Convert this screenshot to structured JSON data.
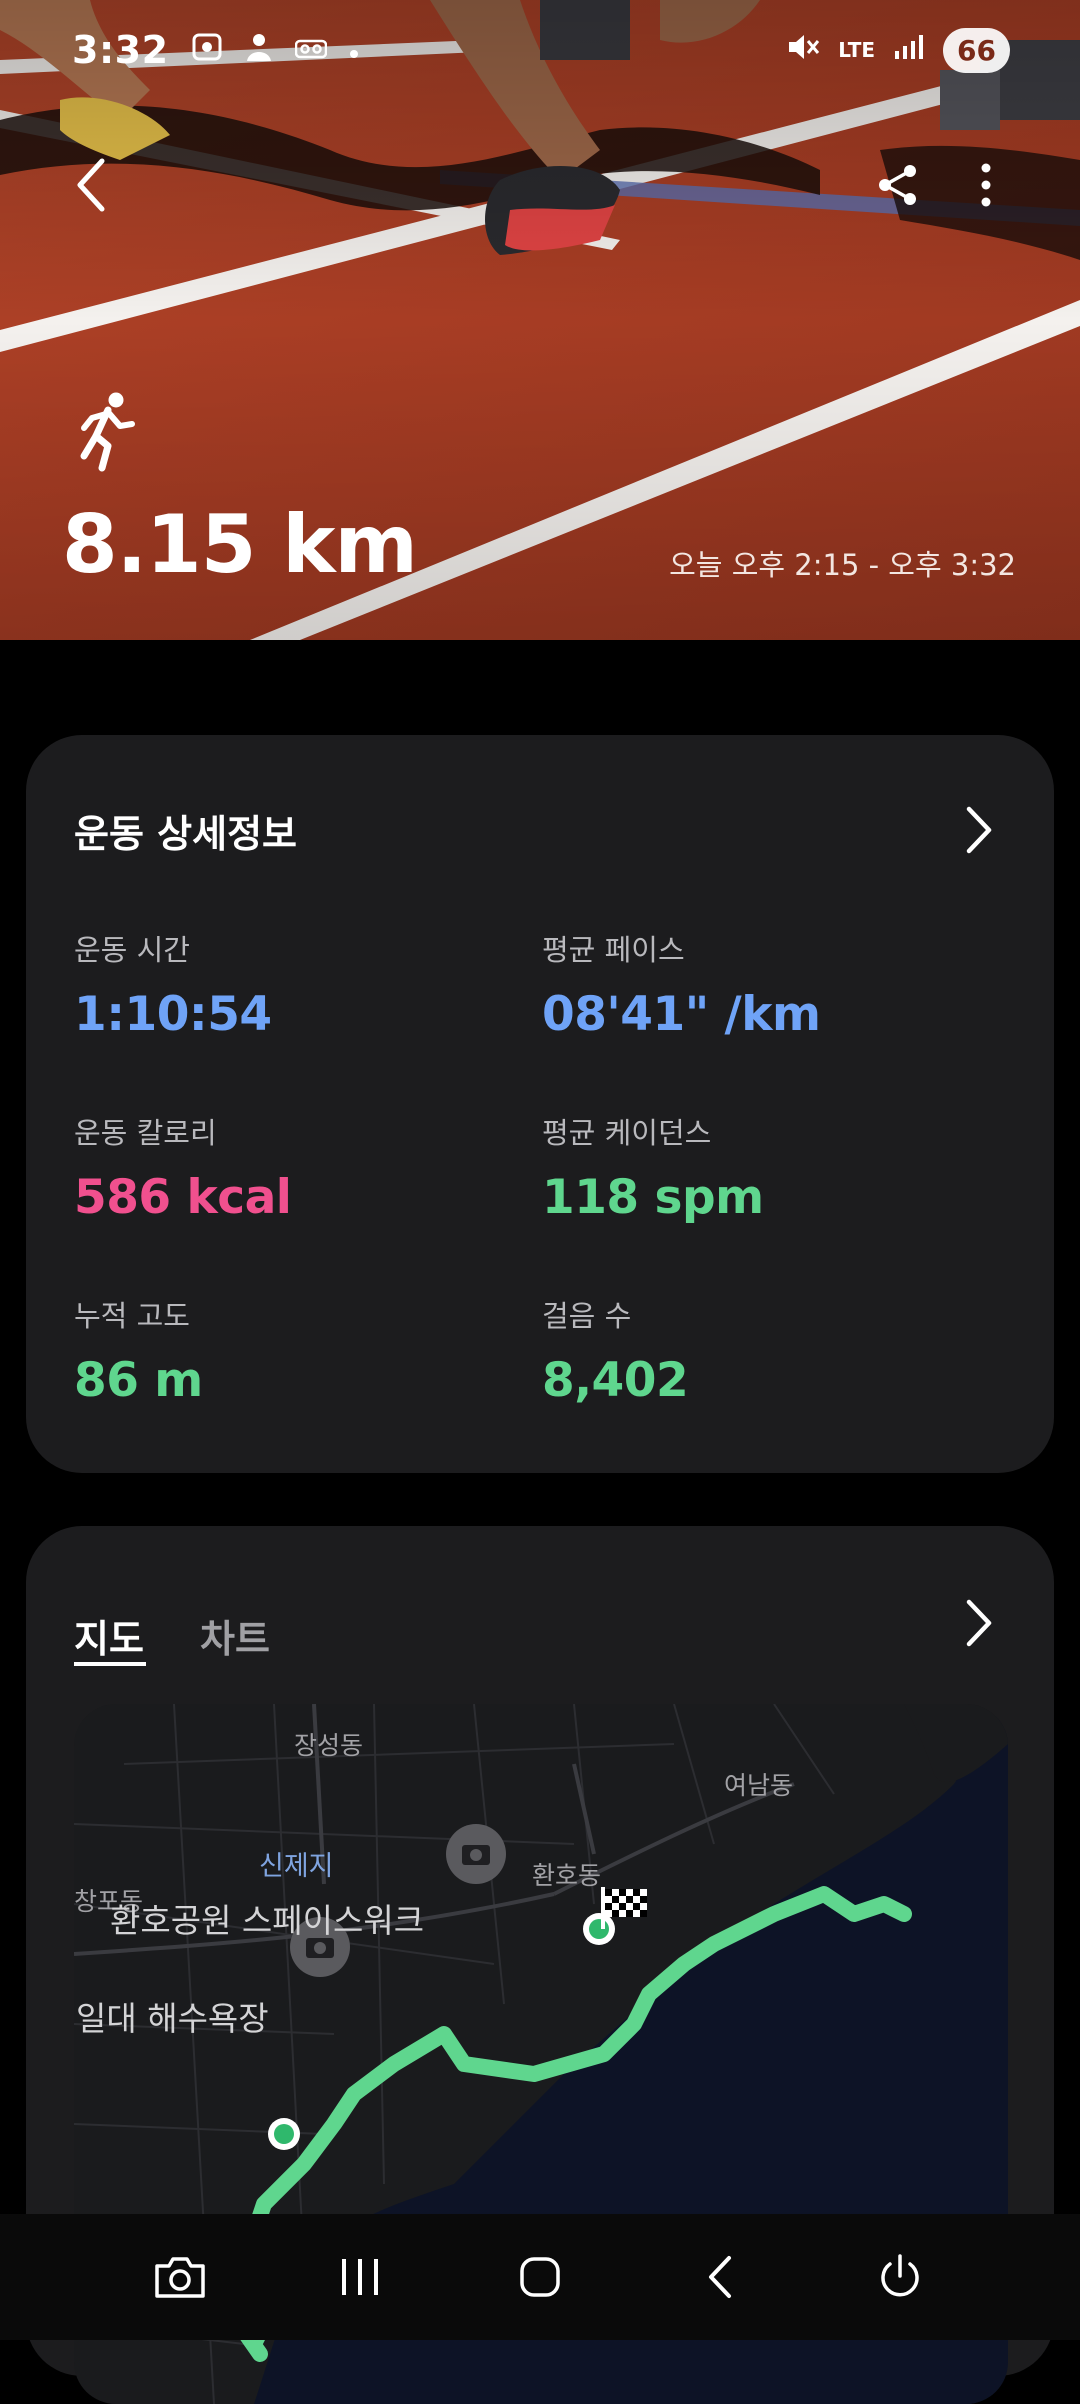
{
  "status_bar": {
    "time": "3:32",
    "battery": "66",
    "network": "LTE",
    "icons": [
      "screenshot-icon",
      "bixby-icon",
      "voicemail-icon",
      "dot-icon",
      "mute-icon",
      "lte-icon",
      "signal-icon",
      "battery-icon"
    ]
  },
  "hero": {
    "distance": "8.15 km",
    "time_range": "오늘 오후 2:15 - 오후 3:32",
    "activity_icon": "running-icon"
  },
  "details": {
    "title": "운동 상세정보",
    "metrics": [
      {
        "label": "운동 시간",
        "value": "1:10:54",
        "color": "#6fa3f7"
      },
      {
        "label": "평균 페이스",
        "value": "08'41\" /km",
        "color": "#6fa3f7"
      },
      {
        "label": "운동 칼로리",
        "value": "586 kcal",
        "color": "#f0508e"
      },
      {
        "label": "평균 케이던스",
        "value": "118 spm",
        "color": "#5fd68e"
      },
      {
        "label": "누적 고도",
        "value": "86 m",
        "color": "#5fd68e"
      },
      {
        "label": "걸음 수",
        "value": "8,402",
        "color": "#5fd68e"
      }
    ]
  },
  "map_card": {
    "tabs": [
      {
        "label": "지도",
        "active": true
      },
      {
        "label": "차트",
        "active": false
      }
    ],
    "map_labels": {
      "jangseong": "장성동",
      "yeonam": "여남동",
      "sinjeji": "신제지",
      "hwanho": "환호동",
      "changpo": "창포동",
      "park": "환호공원 스페이스워크",
      "beach": "일대 해수욕장"
    },
    "route_color": "#5fd68e"
  },
  "nav_bar": {
    "buttons": [
      "camera-icon",
      "recents-icon",
      "home-icon",
      "back-icon",
      "power-icon"
    ]
  }
}
